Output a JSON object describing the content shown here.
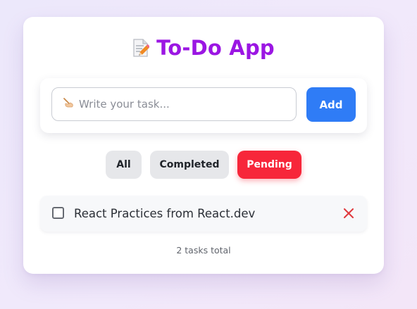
{
  "app": {
    "title": "To-Do App",
    "title_icon": "memo-pencil-icon",
    "accent_color": "#9b16e3"
  },
  "input": {
    "placeholder": "Write your task...",
    "placeholder_icon": "writing-hand-icon",
    "value": ""
  },
  "add_button": {
    "label": "Add",
    "color": "#2f7cf6"
  },
  "filters": [
    {
      "label": "All",
      "active": false
    },
    {
      "label": "Completed",
      "active": false
    },
    {
      "label": "Pending",
      "active": true,
      "color": "#f7263a"
    }
  ],
  "tasks": [
    {
      "text": "React Practices from React.dev",
      "completed": false,
      "delete_icon": "close-icon",
      "delete_color": "#e0393e"
    }
  ],
  "footer": {
    "count_text": "2 tasks total"
  }
}
